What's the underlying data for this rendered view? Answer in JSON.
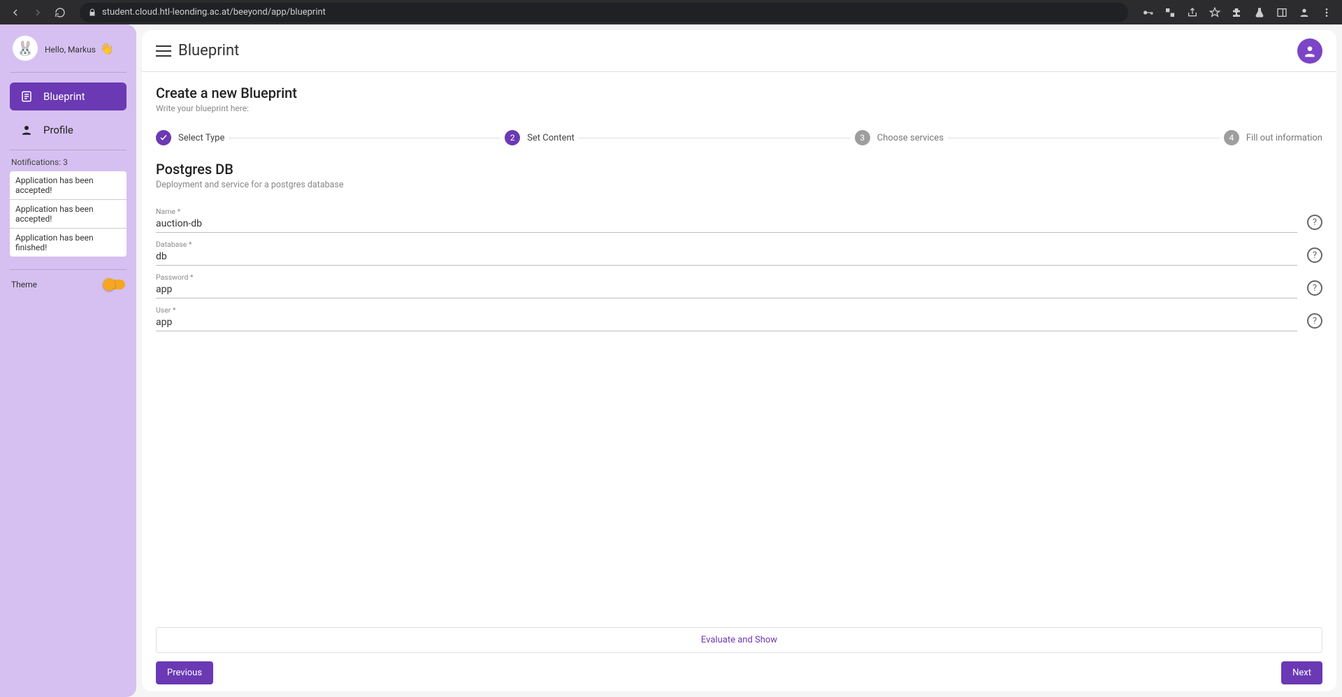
{
  "browser": {
    "url": "student.cloud.htl-leonding.ac.at/beeyond/app/blueprint"
  },
  "sidebar": {
    "greeting": "Hello, Markus",
    "nav": [
      {
        "label": "Blueprint",
        "active": true
      },
      {
        "label": "Profile",
        "active": false
      }
    ],
    "notifications_label": "Notifications: 3",
    "notifications": [
      "Application has been accepted!",
      "Application has been accepted!",
      "Application has been finished!"
    ],
    "theme_label": "Theme"
  },
  "header": {
    "title": "Blueprint"
  },
  "form": {
    "title": "Create a new Blueprint",
    "subtitle": "Write your blueprint here:"
  },
  "stepper": {
    "step1": "Select Type",
    "step2": "Set Content",
    "step3": "Choose services",
    "step4": "Fill out information",
    "step2num": "2",
    "step3num": "3",
    "step4num": "4"
  },
  "section": {
    "title": "Postgres DB",
    "subtitle": "Deployment and service for a postgres database"
  },
  "fields": {
    "name": {
      "label": "Name *",
      "value": "auction-db"
    },
    "database": {
      "label": "Database *",
      "value": "db"
    },
    "password": {
      "label": "Password *",
      "value": "app"
    },
    "user": {
      "label": "User *",
      "value": "app"
    }
  },
  "actions": {
    "evaluate": "Evaluate and Show",
    "previous": "Previous",
    "next": "Next"
  }
}
